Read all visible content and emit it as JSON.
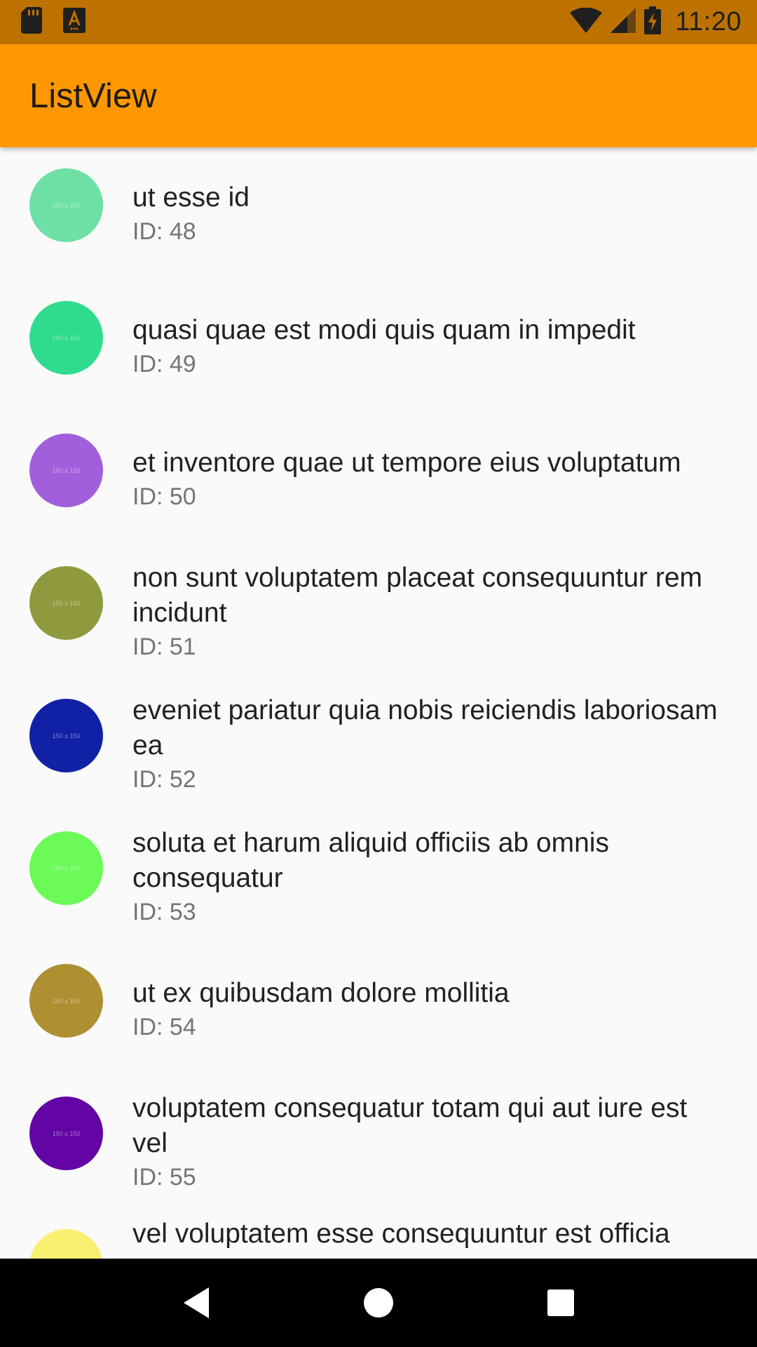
{
  "status_bar": {
    "time": "11:20",
    "icons": [
      "sd-card-icon",
      "a-notification-icon",
      "wifi-icon",
      "cell-signal-icon",
      "battery-charging-icon"
    ]
  },
  "app_bar": {
    "title": "ListView",
    "color": "#ff9800"
  },
  "list": {
    "items": [
      {
        "title": "ut esse id",
        "id_label": "ID: 48",
        "avatar_color": "#6ee0a6",
        "avatar_text": "150 x 150"
      },
      {
        "title": "quasi quae est modi quis quam in impedit",
        "id_label": "ID: 49",
        "avatar_color": "#2fdc8e",
        "avatar_text": "150 x 150"
      },
      {
        "title": "et inventore quae ut tempore eius voluptatum",
        "id_label": "ID: 50",
        "avatar_color": "#a25fdb",
        "avatar_text": "150 x 150"
      },
      {
        "title": "non sunt voluptatem placeat consequuntur rem incidunt",
        "id_label": "ID: 51",
        "avatar_color": "#8f9a3e",
        "avatar_text": "150 x 150"
      },
      {
        "title": "eveniet pariatur quia nobis reiciendis laboriosam ea",
        "id_label": "ID: 52",
        "avatar_color": "#1121a6",
        "avatar_text": "150 x 150"
      },
      {
        "title": "soluta et harum aliquid officiis ab omnis consequatur",
        "id_label": "ID: 53",
        "avatar_color": "#6cfa59",
        "avatar_text": "150 x 150"
      },
      {
        "title": "ut ex quibusdam dolore mollitia",
        "id_label": "ID: 54",
        "avatar_color": "#ae9032",
        "avatar_text": "150 x 150"
      },
      {
        "title": "voluptatem consequatur totam qui aut iure est vel",
        "id_label": "ID: 55",
        "avatar_color": "#6205a4",
        "avatar_text": "150 x 150"
      },
      {
        "title": "vel voluptatem esse consequuntur est officia",
        "id_label": "",
        "avatar_color": "#f9ef70",
        "avatar_text": ""
      }
    ]
  },
  "nav_bar": {
    "buttons": [
      "back-icon",
      "home-icon",
      "recents-icon"
    ]
  }
}
